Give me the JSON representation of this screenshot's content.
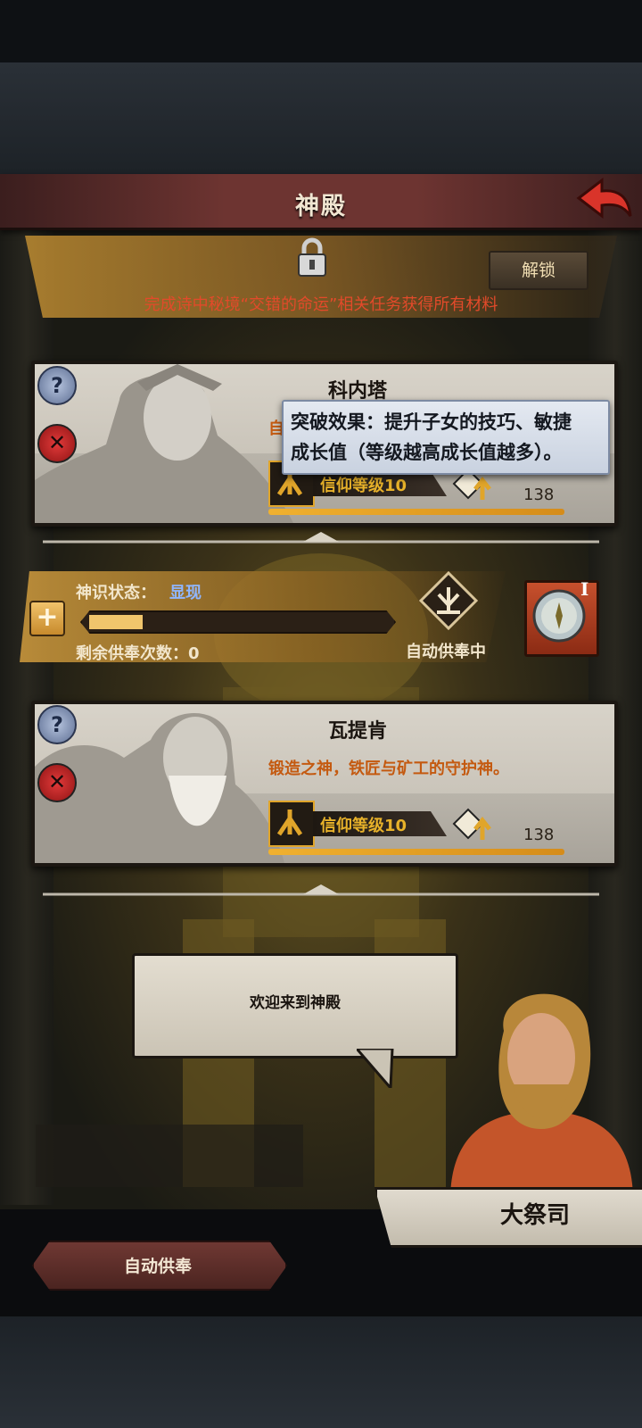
{
  "header": {
    "title": "神殿"
  },
  "unlock": {
    "button_label": "解锁",
    "requirement": "完成诗中秘境“交错的命运”相关任务获得所有材料"
  },
  "deities": [
    {
      "name": "科内塔",
      "description": "自",
      "faith_label": "信仰等级10",
      "faith_value": "138",
      "faith_progress": 1.0
    },
    {
      "name": "瓦提肯",
      "description": "锻造之神，铁匠与矿工的守护神。",
      "faith_label": "信仰等级10",
      "faith_value": "138",
      "faith_progress": 1.0
    }
  ],
  "tooltip": {
    "line1": "突破效果：提升子女的技巧、敏捷",
    "line2": "成长值（等级越高成长值越多）。"
  },
  "divinity": {
    "status_label": "神识状态：",
    "status_value": "显现",
    "remaining_label": "剩余供奉次数：0",
    "auto_status": "自动供奉中",
    "progress": 0.18,
    "medal_rank": "I"
  },
  "dialog": {
    "speech": "欢迎来到神殿",
    "speaker": "大祭司"
  },
  "footer": {
    "auto_button": "自动供奉"
  },
  "colors": {
    "accent_gold": "#e0a52a",
    "warning_red": "#e24a2a",
    "header_red": "#6d3431",
    "status_blue": "#8fb6ff"
  }
}
